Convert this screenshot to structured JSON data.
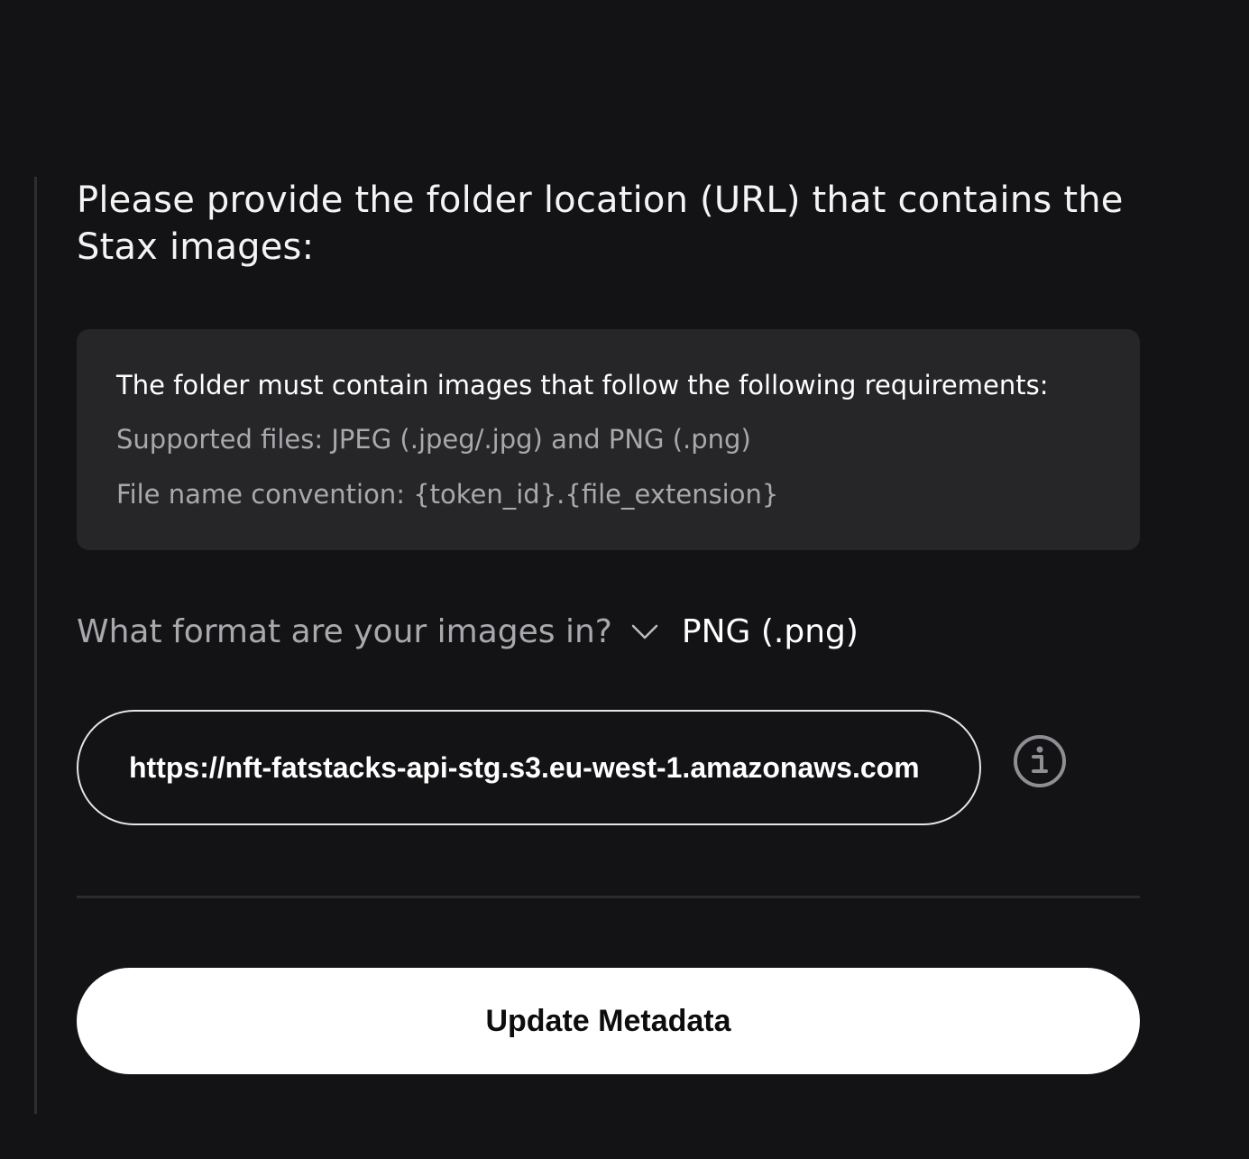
{
  "heading": "Please provide the folder location (URL) that contains the Stax images:",
  "requirements": {
    "title": "The folder must contain images that follow the following requirements:",
    "supported_files": "Supported files: JPEG (.jpeg/.jpg) and PNG (.png)",
    "naming_convention": "File name convention: {token_id}.{file_extension}"
  },
  "format_select": {
    "label": "What format are your images in?",
    "selected": "PNG (.png)",
    "icon": "chevron-down-icon"
  },
  "url_input": {
    "value": "https://nft-fatstacks-api-stg.s3.eu-west-1.amazonaws.com",
    "info_icon": "info-icon"
  },
  "submit": {
    "label": "Update Metadata"
  },
  "colors": {
    "background": "#131315",
    "panel": "#262628",
    "muted_text": "#a9a9ad",
    "button_bg": "#ffffff"
  }
}
